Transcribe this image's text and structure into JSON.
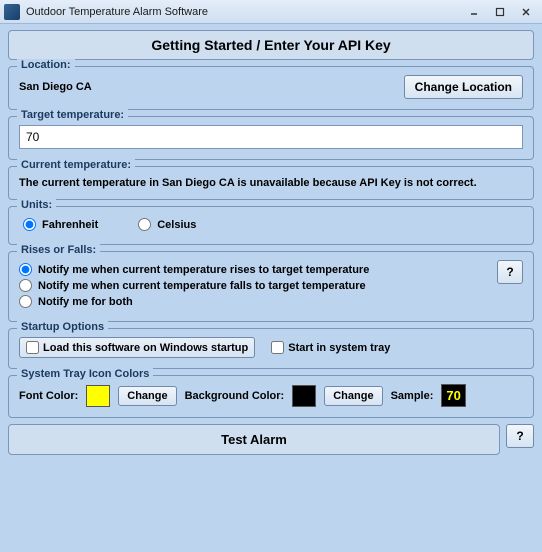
{
  "window": {
    "title": "Outdoor Temperature Alarm Software"
  },
  "header_button": "Getting Started / Enter Your API Key",
  "location": {
    "legend": "Location:",
    "value": "San Diego CA",
    "change_btn": "Change Location"
  },
  "target": {
    "legend": "Target temperature:",
    "value": "70"
  },
  "current": {
    "legend": "Current temperature:",
    "status": "The current temperature in San Diego CA is unavailable because API Key is not correct."
  },
  "units": {
    "legend": "Units:",
    "fahrenheit": "Fahrenheit",
    "celsius": "Celsius",
    "selected": "fahrenheit"
  },
  "rises": {
    "legend": "Rises or Falls:",
    "opt_rise": "Notify me when current temperature rises to target temperature",
    "opt_fall": "Notify me when current temperature falls to target temperature",
    "opt_both": "Notify me for both",
    "help": "?"
  },
  "startup": {
    "legend": "Startup Options",
    "load": "Load this software on Windows startup",
    "tray": "Start in system tray"
  },
  "tray_colors": {
    "legend": "System Tray Icon Colors",
    "font_label": "Font Color:",
    "font_color": "#ffff00",
    "change": "Change",
    "bg_label": "Background Color:",
    "bg_color": "#000000",
    "sample_label": "Sample:",
    "sample_value": "70"
  },
  "test_alarm": "Test Alarm",
  "help": "?"
}
